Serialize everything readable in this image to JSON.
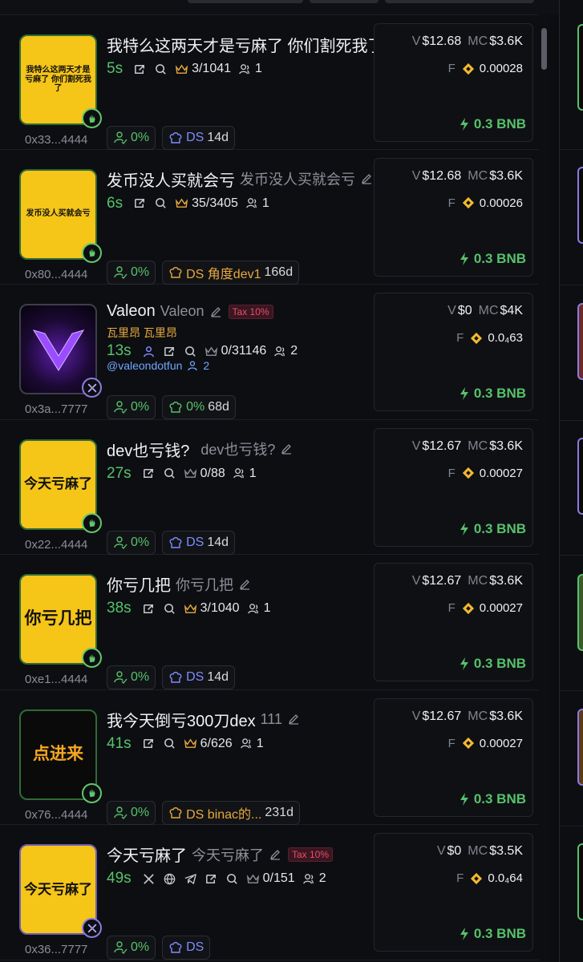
{
  "tokens": [
    {
      "name": "我特么这两天才是亏麻了 你们割死我了",
      "ticker": "",
      "tax": "",
      "avatar_text": "我特么这两天才是亏麻了 你们割死我了",
      "avatar_style": "yellow",
      "avatar_text_size": "sm",
      "age": "5s",
      "holders_ratio": "3/1041",
      "holders": "1",
      "address": "0x33...4444",
      "dev_pct": "0%",
      "ds_label": "DS",
      "ds_extra": "",
      "ds_days": "14d",
      "v": "$12.68",
      "mc": "$3.6K",
      "f": "0.00028",
      "buy": "0.3 BNB"
    },
    {
      "name": "发币没人买就会亏",
      "ticker": "发币没人买就会亏",
      "tax": "",
      "avatar_text": "发币没人买就会亏",
      "avatar_style": "yellow",
      "avatar_text_size": "sm",
      "age": "6s",
      "holders_ratio": "35/3405",
      "holders": "1",
      "address": "0x80...4444",
      "dev_pct": "0%",
      "ds_label": "DS 角度dev1",
      "ds_extra": "",
      "ds_days": "166d",
      "v": "$12.68",
      "mc": "$3.6K",
      "f": "0.00026",
      "buy": "0.3 BNB"
    },
    {
      "name": "Valeon",
      "ticker": "Valeon",
      "tax": "Tax 10%",
      "sub_cn": "瓦里昂  瓦里昂",
      "handle": "@valeondotfun",
      "handle_count": "2",
      "age": "13s",
      "holders_ratio": "0/31146",
      "holders": "2",
      "address": "0x3a...7777",
      "dev_pct": "0%",
      "ds_label": "0%",
      "ds_days": "68d",
      "v": "$0",
      "mc": "$4K",
      "f": "0.0₄63",
      "buy": "0.3 BNB"
    },
    {
      "name": "dev也亏钱?",
      "ticker": "dev也亏钱?",
      "tax": "",
      "avatar_text": "今天亏麻了",
      "avatar_style": "yellow",
      "avatar_text_size": "md",
      "age": "27s",
      "holders_ratio": "0/88",
      "holders": "1",
      "address": "0x22...4444",
      "dev_pct": "0%",
      "ds_label": "DS",
      "ds_days": "14d",
      "v": "$12.67",
      "mc": "$3.6K",
      "f": "0.00027",
      "buy": "0.3 BNB"
    },
    {
      "name": "你亏几把",
      "ticker": "你亏几把",
      "tax": "",
      "avatar_text": "你亏几把",
      "avatar_style": "yellow",
      "avatar_text_size": "lg",
      "age": "38s",
      "holders_ratio": "3/1040",
      "holders": "1",
      "address": "0xe1...4444",
      "dev_pct": "0%",
      "ds_label": "DS",
      "ds_days": "14d",
      "v": "$12.67",
      "mc": "$3.6K",
      "f": "0.00027",
      "buy": "0.3 BNB"
    },
    {
      "name": "我今天倒亏300刀dex",
      "ticker": "111",
      "tax": "",
      "avatar_text": "点进来",
      "avatar_style": "black",
      "avatar_text_size": "lg",
      "age": "41s",
      "holders_ratio": "6/626",
      "holders": "1",
      "address": "0x76...4444",
      "dev_pct": "0%",
      "ds_label": "DS binac的...",
      "ds_days": "231d",
      "v": "$12.67",
      "mc": "$3.6K",
      "f": "0.00027",
      "buy": "0.3 BNB"
    },
    {
      "name": "今天亏麻了",
      "ticker": "今天亏麻了",
      "tax": "Tax 10%",
      "avatar_text": "今天亏麻了",
      "avatar_style": "yellow",
      "avatar_text_size": "md",
      "age": "49s",
      "holders_ratio": "0/151",
      "holders": "2",
      "address": "0x36...7777",
      "dev_pct": "0%",
      "ds_label": "DS",
      "ds_days": "",
      "v": "$0",
      "mc": "$3.5K",
      "f": "0.0₄64",
      "buy": "0.3 BNB"
    }
  ],
  "labels": {
    "v": "V",
    "mc": "MC",
    "f": "F"
  },
  "colors": {
    "green": "#56c26a",
    "ds_blue": "#7f8cff",
    "ds_orange": "#e6a93c",
    "tax_red": "#e84e6a",
    "bnb_yellow": "#f3ba2f"
  }
}
